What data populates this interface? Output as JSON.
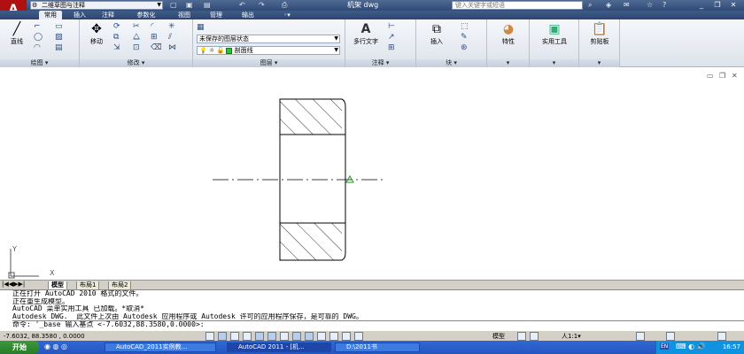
{
  "app": {
    "logo_letter": "A",
    "workspace": "二维草图与注释",
    "title": "机架 dwg",
    "help_placeholder": "键入关键字或短语"
  },
  "ribbon_tabs": [
    "常用",
    "插入",
    "注释",
    "参数化",
    "视图",
    "管理",
    "输出"
  ],
  "ribbon": {
    "draw_panel": "绘图",
    "modify_panel": "修改",
    "layers_panel": "图层",
    "annotation_panel": "注释",
    "block_panel": "块",
    "line_label": "直线",
    "move_label": "移动",
    "layer_state": "未保存的图层状态",
    "current_layer": "剖面线",
    "mtext_label": "多行文字",
    "insert_label": "插入",
    "properties_label": "特性",
    "utilities_label": "实用工具",
    "clipboard_label": "剪贴板"
  },
  "layout_tabs": [
    "模型",
    "布局1",
    "布局2"
  ],
  "command_lines": [
    "正在打开 AutoCAD 2010 格式的文件。",
    "正在重生成模型。",
    "AutoCAD 菜单实用工具 已加载。*取消*",
    "Autodesk DWG.  此文件上次由 Autodesk 应用程序或 Autodesk 许可的应用程序保存，是可靠的 DWG。",
    "命令: '_base 输入基点 <-7.6032,88.3580,0.0000>:"
  ],
  "status": {
    "coords": "-7.6032, 88.3580 , 0.0000",
    "model_label": "模型",
    "scale": "1:1"
  },
  "taskbar": {
    "start": "开始",
    "tasks": [
      "AutoCAD_2011实例教...",
      "AutoCAD 2011 - [机...",
      "D:\\2011书"
    ],
    "lang": "EN",
    "time": "16:57"
  },
  "colors": {
    "title_bar": "#2f4a75",
    "ribbon_bg": "#e9eef6",
    "layer_color": "#2cc22c",
    "logo": "#b01010",
    "ucs_icon": "#555555"
  }
}
